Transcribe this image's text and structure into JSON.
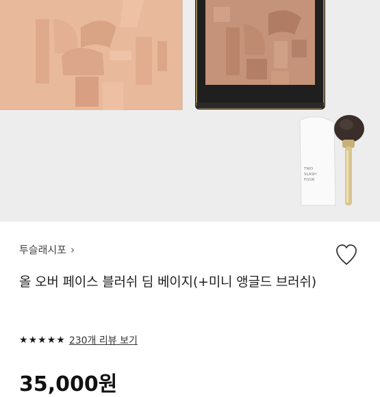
{
  "product": {
    "brand": "투슬래시포",
    "brand_arrow_icon": "chevron-right-icon",
    "title": "올 오버 페이스 블러쉬 딤 베이지(+미니 앵글드 브러쉬)",
    "rating": {
      "stars": 5,
      "review_link": "230개 리뷰 보기"
    },
    "price": "35,000원",
    "wishlist_icon": "heart-outline-icon"
  },
  "image": {
    "pouch_text": "TWO SLASH FOUR"
  },
  "colors": {
    "background": "#ededed",
    "palette_left": "#e7b799",
    "palette_right": "#c49278",
    "compact_case": "#222222",
    "gold_trim": "#bfa56c"
  }
}
